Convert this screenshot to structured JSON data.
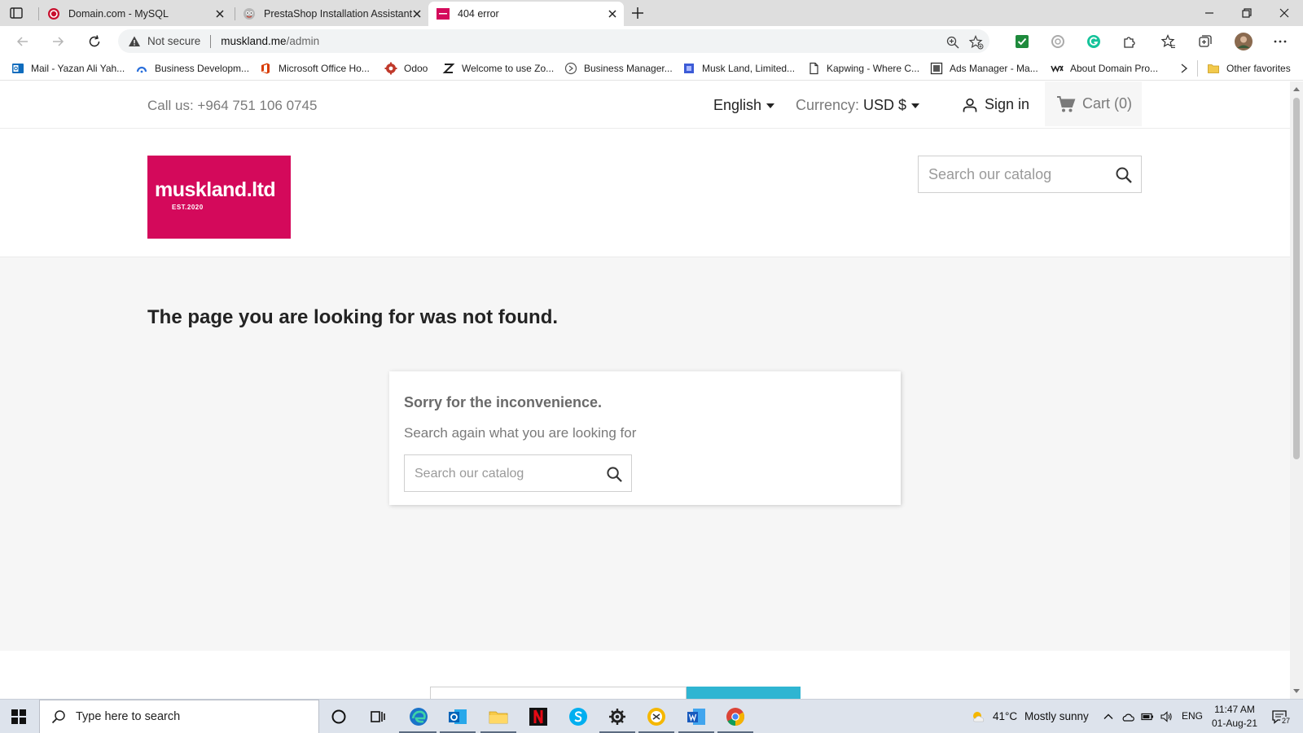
{
  "browser": {
    "tabs": [
      {
        "title": "Domain.com - MySQL",
        "active": false
      },
      {
        "title": "PrestaShop Installation Assistant",
        "active": false
      },
      {
        "title": "404 error",
        "active": true
      }
    ],
    "address": {
      "security_label": "Not secure",
      "url_host": "muskland.me",
      "url_path": "/admin"
    },
    "favorites": [
      "Mail - Yazan Ali Yah...",
      "Business Developm...",
      "Microsoft Office Ho...",
      "Odoo",
      "Welcome to use Zo...",
      "Business Manager...",
      "Musk Land, Limited...",
      "Kapwing - Where C...",
      "Ads Manager - Ma...",
      "About Domain Pro..."
    ],
    "other_favorites": "Other favorites"
  },
  "shop": {
    "call_us": "Call us: +964 751 106 0745",
    "language": "English",
    "currency_label": "Currency:",
    "currency_value": "USD $",
    "sign_in": "Sign in",
    "cart": "Cart (0)",
    "logo_text": "muskland.ltd",
    "logo_sub": "EST.2020",
    "search_placeholder": "Search our catalog",
    "page_title": "The page you are looking for was not found.",
    "sorry": "Sorry for the inconvenience.",
    "search_again": "Search again what you are looking for",
    "brand_color": "#d4095b",
    "accent_color": "#2fb5d2"
  },
  "taskbar": {
    "search_placeholder": "Type here to search",
    "weather_temp": "41°C",
    "weather_text": "Mostly sunny",
    "lang": "ENG",
    "time": "11:47 AM",
    "date": "01-Aug-21",
    "notifications": "27"
  }
}
